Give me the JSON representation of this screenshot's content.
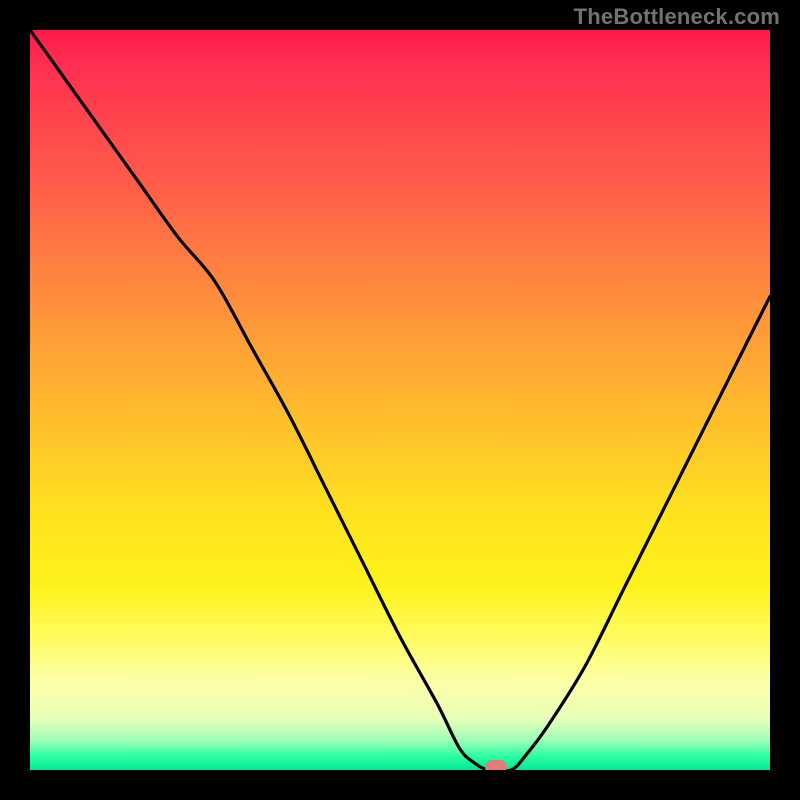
{
  "watermark": "TheBottleneck.com",
  "colors": {
    "frame_bg": "#000000",
    "gradient_top": "#ff1a4c",
    "gradient_bottom": "#00e996",
    "curve_stroke": "#000000",
    "marker_fill": "#e47b7b",
    "watermark_text": "#727272"
  },
  "chart_data": {
    "type": "line",
    "title": "",
    "xlabel": "",
    "ylabel": "",
    "xlim": [
      0,
      100
    ],
    "ylim": [
      0,
      100
    ],
    "legend": false,
    "grid": false,
    "series": [
      {
        "name": "bottleneck-curve",
        "x": [
          0,
          5,
          10,
          15,
          20,
          25,
          30,
          35,
          40,
          45,
          50,
          55,
          58,
          60,
          62,
          65,
          67,
          70,
          75,
          80,
          85,
          90,
          95,
          100
        ],
        "y": [
          100,
          93,
          86,
          79,
          72,
          66,
          57,
          48,
          38,
          28,
          18,
          9,
          3,
          1,
          0,
          0,
          2,
          6,
          14,
          24,
          34,
          44,
          54,
          64
        ]
      }
    ],
    "annotations": [
      {
        "name": "min-marker",
        "x": 63,
        "y": 0,
        "shape": "pill",
        "color": "#e47b7b"
      }
    ],
    "background": {
      "type": "vertical-gradient",
      "description": "red at top through orange/yellow to green at bottom",
      "stops": [
        {
          "pos": 0.0,
          "color": "#ff1a4c"
        },
        {
          "pos": 0.5,
          "color": "#ffb72f"
        },
        {
          "pos": 0.82,
          "color": "#fffc60"
        },
        {
          "pos": 1.0,
          "color": "#00e996"
        }
      ]
    }
  }
}
